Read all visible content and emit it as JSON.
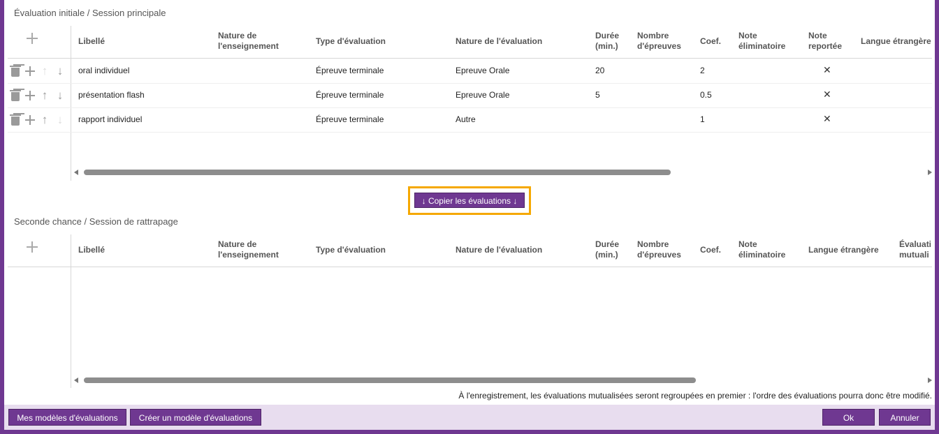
{
  "initial": {
    "title": "Évaluation initiale / Session principale",
    "columns": {
      "libelle": "Libellé",
      "nature_ens_1": "Nature de",
      "nature_ens_2": "l'enseignement",
      "type_eval": "Type d'évaluation",
      "nature_eval": "Nature de l'évaluation",
      "duree_1": "Durée",
      "duree_2": "(min.)",
      "nb_1": "Nombre",
      "nb_2": "d'épreuves",
      "coef": "Coef.",
      "elim_1": "Note",
      "elim_2": "éliminatoire",
      "rep_1": "Note",
      "rep_2": "reportée",
      "langue": "Langue étrangère"
    },
    "rows": [
      {
        "libelle": "oral individuel",
        "type": "Épreuve terminale",
        "nature": "Epreuve Orale",
        "duree": "20",
        "coef": "2",
        "reportee": "✕"
      },
      {
        "libelle": "présentation flash",
        "type": "Épreuve terminale",
        "nature": "Epreuve Orale",
        "duree": "5",
        "coef": "0.5",
        "reportee": "✕"
      },
      {
        "libelle": "rapport individuel",
        "type": "Épreuve terminale",
        "nature": "Autre",
        "duree": "",
        "coef": "1",
        "reportee": "✕"
      }
    ]
  },
  "copy_button": "↓ Copier les évaluations ↓",
  "second": {
    "title": "Seconde chance / Session de rattrapage",
    "columns": {
      "libelle": "Libellé",
      "nature_ens_1": "Nature de",
      "nature_ens_2": "l'enseignement",
      "type_eval": "Type d'évaluation",
      "nature_eval": "Nature de l'évaluation",
      "duree_1": "Durée",
      "duree_2": "(min.)",
      "nb_1": "Nombre",
      "nb_2": "d'épreuves",
      "coef": "Coef.",
      "elim_1": "Note",
      "elim_2": "éliminatoire",
      "langue": "Langue étrangère",
      "mutu_1": "Évaluati",
      "mutu_2": "mutuali"
    }
  },
  "notice": "À l'enregistrement, les évaluations mutualisées seront regroupées en premier : l'ordre des évaluations pourra donc être modifié.",
  "footer": {
    "my_models": "Mes modèles d'évaluations",
    "create_model": "Créer un modèle d'évaluations",
    "ok": "Ok",
    "cancel": "Annuler"
  },
  "colors": {
    "accent": "#6f3891",
    "highlight": "#f5a800",
    "footer_bg": "#e8ddef"
  },
  "icons": [
    "plus-icon",
    "trash-icon",
    "arrow-up-icon",
    "arrow-down-icon",
    "close-icon"
  ]
}
